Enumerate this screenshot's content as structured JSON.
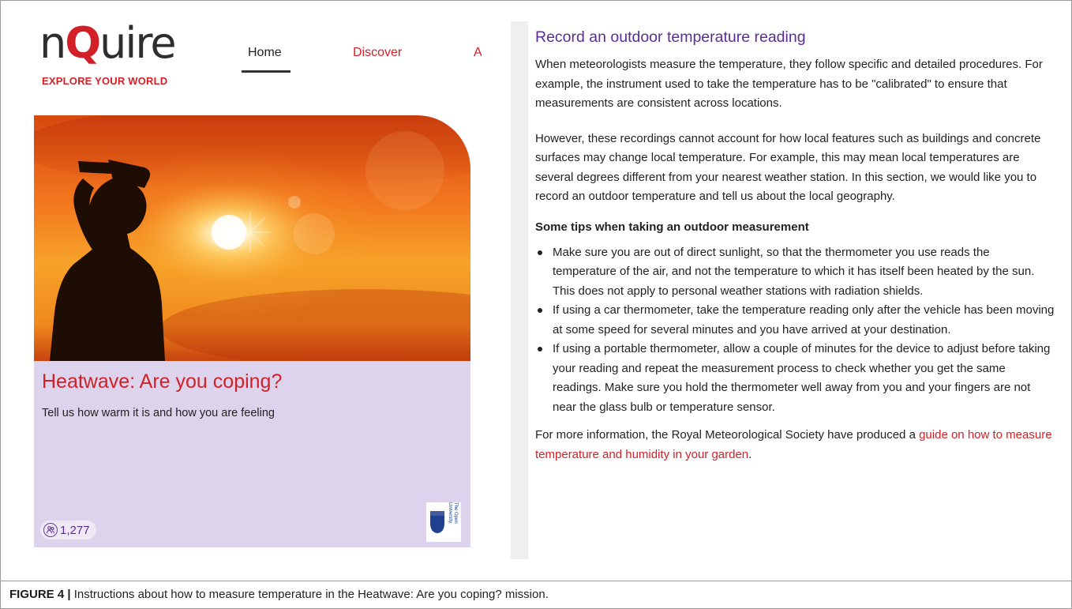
{
  "app": {
    "logo_text_before": "n",
    "logo_text_q": "Q",
    "logo_text_after": "uire",
    "tagline": "EXPLORE YOUR WORLD"
  },
  "nav": {
    "items": [
      {
        "label": "Home",
        "active": true
      },
      {
        "label": "Discover",
        "active": false
      },
      {
        "label": "A",
        "active": false
      }
    ]
  },
  "mission_card": {
    "title": "Heatwave: Are you coping?",
    "subtitle": "Tell us how warm it is and how you are feeling",
    "participants": "1,277",
    "participants_icon": "participants-icon",
    "partner_logo_text": "The Open University"
  },
  "instructions": {
    "title": "Record an outdoor temperature reading",
    "paragraph_1": "When meteorologists measure the temperature, they follow specific and detailed procedures. For example, the instrument used to take the temperature has to be \"calibrated\" to ensure that measurements are consistent across locations.",
    "paragraph_2": "However, these recordings cannot account for how local features such as buildings and concrete surfaces may change local temperature. For example, this may mean local temperatures are several degrees different from your nearest weather station.  In this section, we would like you to record an outdoor temperature and tell us about the local geography.",
    "tips_heading": "Some tips when taking an outdoor measurement",
    "tips": [
      "Make sure you are out of direct sunlight, so that the thermometer you use reads the temperature of the air, and not the temperature to which it has itself been heated by the sun. This does not apply to personal weather stations with radiation shields.",
      "If using a car thermometer, take the temperature reading only after the vehicle has been moving at some speed for several minutes and you have arrived at your destination.",
      "If using a portable thermometer, allow a couple of minutes for the device to adjust before taking your reading and repeat the measurement process to check whether you get the same readings. Make sure you hold the thermometer well away from you and your fingers are not near the glass bulb or temperature sensor."
    ],
    "more_info_prefix": "For more information, the Royal Meteorological Society have produced a ",
    "more_info_link": "guide on how to measure temperature and humidity in your garden",
    "more_info_suffix": "."
  },
  "caption": {
    "label": "FIGURE 4 |",
    "text": " Instructions about how to measure temperature in the Heatwave: Are you coping? mission."
  },
  "colors": {
    "brand_red": "#d31f27",
    "heading_purple": "#5b2d91",
    "card_lavender": "#ddd3ec"
  }
}
